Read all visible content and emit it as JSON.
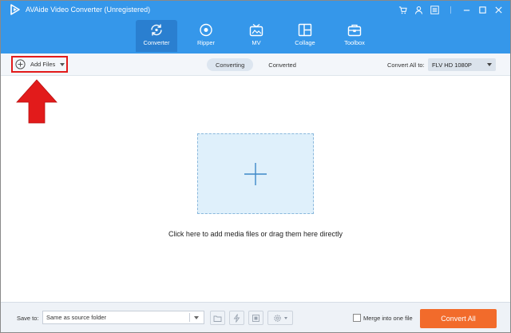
{
  "window": {
    "title": "AVAide Video Converter (Unregistered)",
    "controls": [
      "cart-icon",
      "user-icon",
      "menu-icon",
      "minimize-icon",
      "maximize-icon",
      "close-icon"
    ]
  },
  "nav": {
    "tabs": [
      {
        "label": "Converter",
        "icon": "converter-icon",
        "active": true
      },
      {
        "label": "Ripper",
        "icon": "ripper-icon",
        "active": false
      },
      {
        "label": "MV",
        "icon": "mv-icon",
        "active": false
      },
      {
        "label": "Collage",
        "icon": "collage-icon",
        "active": false
      },
      {
        "label": "Toolbox",
        "icon": "toolbox-icon",
        "active": false
      }
    ]
  },
  "toolbar": {
    "add_files_label": "Add Files",
    "segments": [
      {
        "label": "Converting",
        "active": true
      },
      {
        "label": "Converted",
        "active": false
      }
    ],
    "convert_all_to_label": "Convert All to:",
    "format_value": "FLV HD 1080P"
  },
  "main": {
    "drop_hint": "Click here to add media files or drag them here directly"
  },
  "bottom": {
    "save_to_label": "Save to:",
    "save_to_value": "Same as source folder",
    "merge_label": "Merge into one file",
    "merge_checked": false,
    "convert_all_button": "Convert All"
  },
  "colors": {
    "header": "#3597ea",
    "annotation_red": "#e21b1b",
    "convert_button": "#f26b2b",
    "drop_zone": "#dff0fb"
  }
}
